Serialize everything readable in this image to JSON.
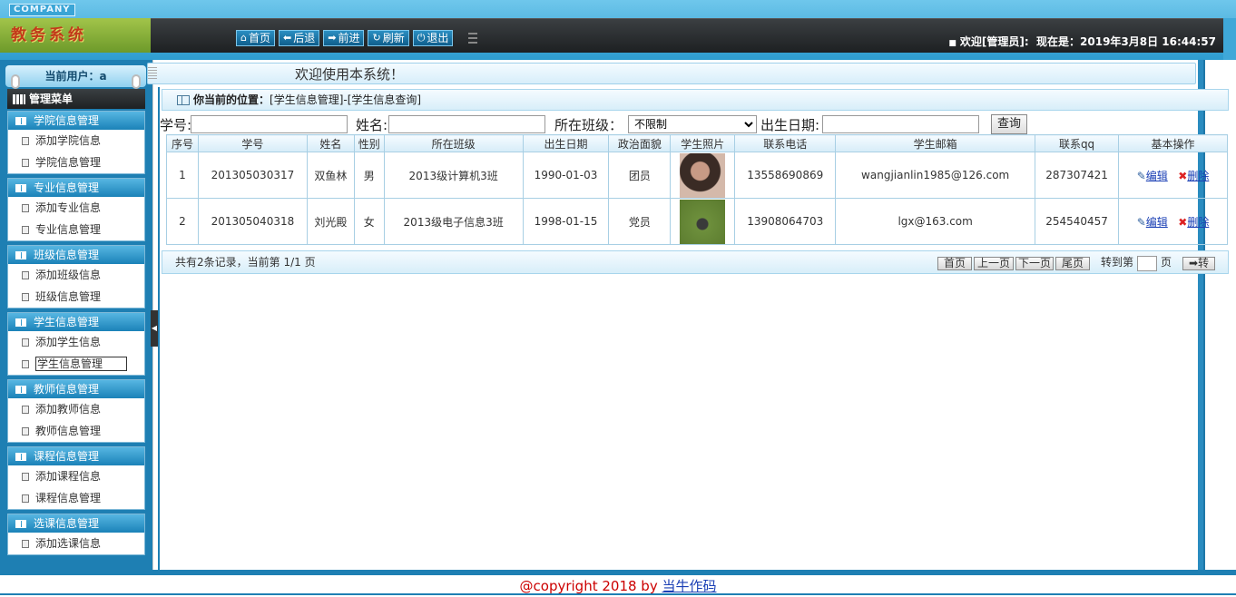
{
  "header": {
    "company": "COMPANY",
    "logo_text": "教务系统",
    "nav": [
      {
        "label": "首页",
        "icon": "home-icon"
      },
      {
        "label": "后退",
        "icon": "arrow-left-icon"
      },
      {
        "label": "前进",
        "icon": "arrow-right-icon"
      },
      {
        "label": "刷新",
        "icon": "refresh-icon"
      },
      {
        "label": "退出",
        "icon": "power-icon"
      }
    ],
    "welcome": "欢迎[管理员]:",
    "now_label": "现在是：2019年3月8日 16:44:57"
  },
  "sidebar": {
    "current_user": "当前用户：a",
    "menu_title": "管理菜单",
    "groups": [
      {
        "title": "学院信息管理",
        "items": [
          "添加学院信息",
          "学院信息管理"
        ]
      },
      {
        "title": "专业信息管理",
        "items": [
          "添加专业信息",
          "专业信息管理"
        ]
      },
      {
        "title": "班级信息管理",
        "items": [
          "添加班级信息",
          "班级信息管理"
        ]
      },
      {
        "title": "学生信息管理",
        "items": [
          "添加学生信息",
          "学生信息管理"
        ]
      },
      {
        "title": "教师信息管理",
        "items": [
          "添加教师信息",
          "教师信息管理"
        ]
      },
      {
        "title": "课程信息管理",
        "items": [
          "添加课程信息",
          "课程信息管理"
        ]
      },
      {
        "title": "选课信息管理",
        "items": [
          "添加选课信息"
        ]
      }
    ]
  },
  "main": {
    "welcome_title": "欢迎使用本系统！",
    "breadcrumb_label": "你当前的位置：",
    "breadcrumb_path": "[学生信息管理]-[学生信息查询]",
    "search": {
      "sno_label": "学号:",
      "name_label": "姓名:",
      "class_label": "所在班级：",
      "class_value": "不限制",
      "birth_label": "出生日期:",
      "query_button": "查询"
    },
    "table": {
      "columns": [
        "序号",
        "学号",
        "姓名",
        "性别",
        "所在班级",
        "出生日期",
        "政治面貌",
        "学生照片",
        "联系电话",
        "学生邮箱",
        "联系qq",
        "基本操作"
      ],
      "rows": [
        [
          "1",
          "201305030317",
          "双鱼林",
          "男",
          "2013级计算机3班",
          "1990-01-03",
          "团员",
          "",
          "13558690869",
          "wangjianlin1985@126.com",
          "287307421"
        ],
        [
          "2",
          "201305040318",
          "刘光殿",
          "女",
          "2013级电子信息3班",
          "1998-01-15",
          "党员",
          "",
          "13908064703",
          "lgx@163.com",
          "254540457"
        ]
      ],
      "edit_label": "编辑",
      "delete_label": "删除"
    },
    "pager": {
      "info": "共有2条记录，当前第 1/1 页",
      "first": "首页",
      "prev": "上一页",
      "next": "下一页",
      "last": "尾页",
      "goto_label": "转到第",
      "page_unit": "页",
      "go_button": "➡转"
    }
  },
  "footer": {
    "copyright": "@copyright 2018 by ",
    "link": "当牛作码"
  }
}
